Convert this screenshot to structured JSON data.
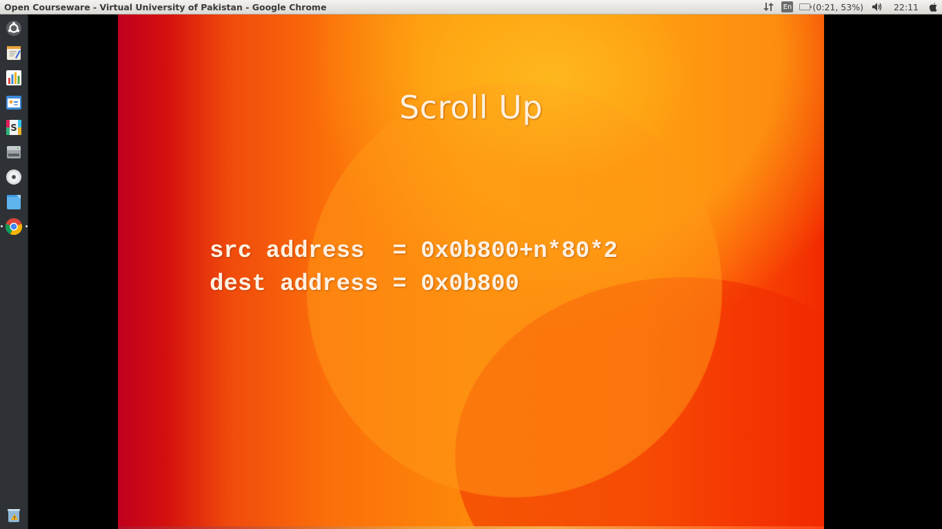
{
  "window": {
    "title": "Open Courseware - Virtual University of Pakistan - Google Chrome"
  },
  "panel": {
    "keyboard_layout": "En",
    "battery_text": "(0:21, 53%)",
    "clock": "22:11",
    "icons": [
      "network-icon",
      "battery-icon",
      "volume-icon",
      "power-icon"
    ]
  },
  "launcher": {
    "items": [
      {
        "name": "dash-home",
        "icon": "ubuntu-logo-icon"
      },
      {
        "name": "text-editor",
        "icon": "text-editor-icon"
      },
      {
        "name": "spreadsheet",
        "icon": "spreadsheet-icon"
      },
      {
        "name": "presentation",
        "icon": "presentation-icon"
      },
      {
        "name": "slack",
        "icon": "slack-icon",
        "label": "S"
      },
      {
        "name": "files-drive",
        "icon": "drive-icon"
      },
      {
        "name": "optical-disc",
        "icon": "disc-icon"
      },
      {
        "name": "files",
        "icon": "folder-icon"
      },
      {
        "name": "chrome",
        "icon": "chrome-icon",
        "running": true
      },
      {
        "name": "trash",
        "icon": "trash-icon"
      }
    ]
  },
  "slide": {
    "title": "Scroll Up",
    "lines": [
      "src address  = 0x0b800+n*80*2",
      "dest address = 0x0b800"
    ]
  }
}
